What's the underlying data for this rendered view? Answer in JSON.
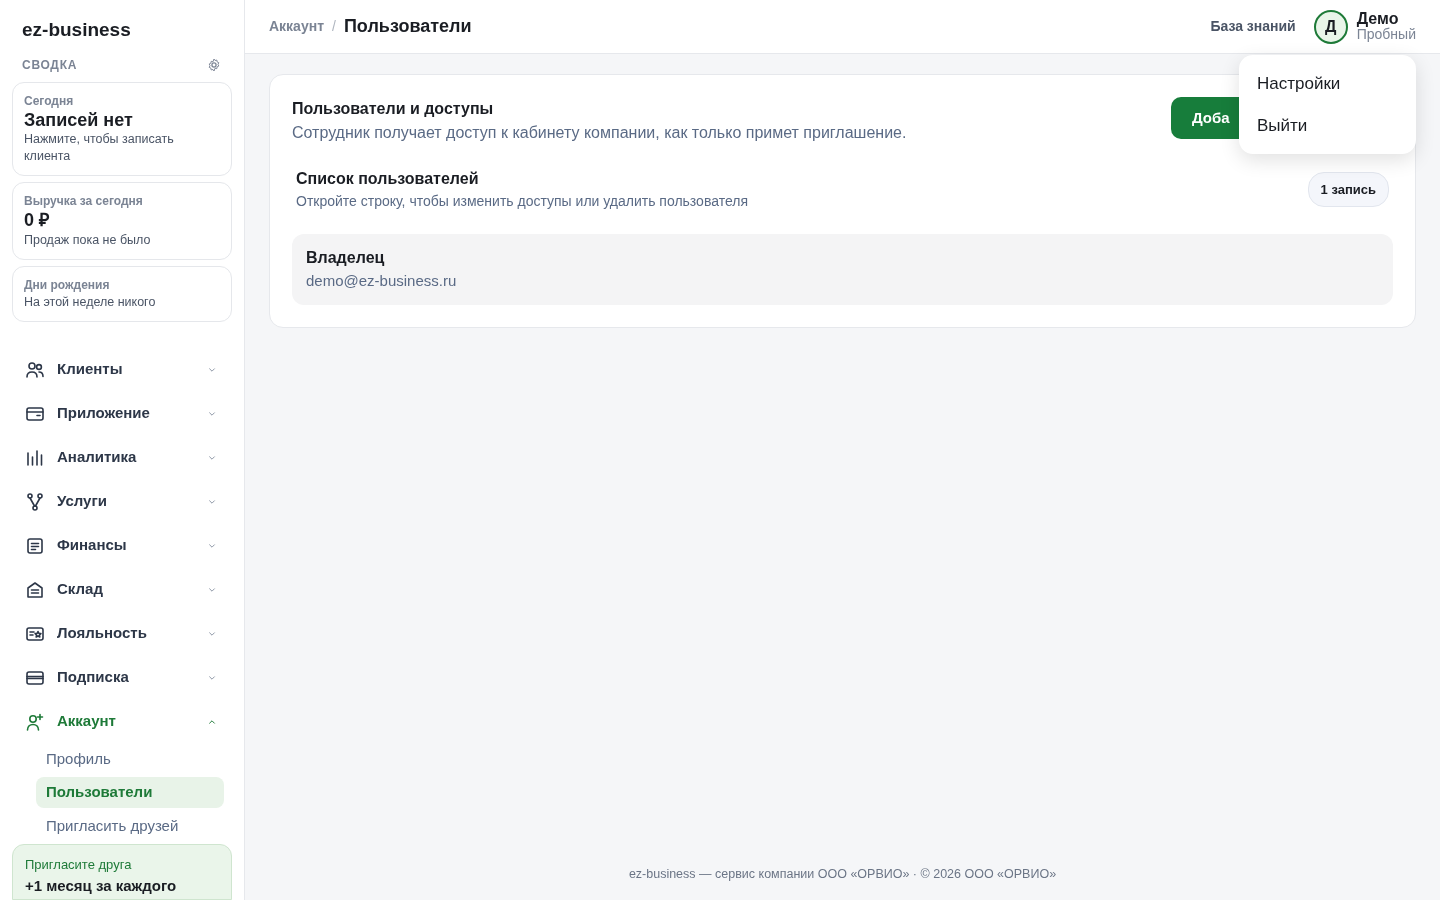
{
  "brand": "ez-business",
  "summary": {
    "title": "СВОДКА",
    "cards": [
      {
        "label": "Сегодня",
        "value": "Записей нет",
        "note": "Нажмите, чтобы записать клиента"
      },
      {
        "label": "Выручка за сегодня",
        "value": "0 ₽",
        "note": "Продаж пока не было"
      },
      {
        "label": "Дни рождения",
        "note": "На этой неделе никого"
      }
    ]
  },
  "nav": [
    {
      "label": "Клиенты",
      "expanded": false,
      "selected": false
    },
    {
      "label": "Приложение",
      "expanded": false,
      "selected": false
    },
    {
      "label": "Аналитика",
      "expanded": false,
      "selected": false
    },
    {
      "label": "Услуги",
      "expanded": false,
      "selected": false
    },
    {
      "label": "Финансы",
      "expanded": false,
      "selected": false
    },
    {
      "label": "Склад",
      "expanded": false,
      "selected": false
    },
    {
      "label": "Лояльность",
      "expanded": false,
      "selected": false
    },
    {
      "label": "Подписка",
      "expanded": false,
      "selected": false
    },
    {
      "label": "Аккаунт",
      "expanded": true,
      "selected": true,
      "children": [
        {
          "label": "Профиль",
          "selected": false
        },
        {
          "label": "Пользователи",
          "selected": true
        },
        {
          "label": "Пригласить друзей",
          "selected": false
        }
      ]
    }
  ],
  "promo": {
    "title": "Пригласите друга",
    "text": "+1 месяц за каждого"
  },
  "breadcrumb_separator": "/",
  "breadcrumb": [
    {
      "label": "Аккаунт",
      "selected": false
    },
    {
      "label": "Пользователи",
      "selected": true
    }
  ],
  "header": {
    "help_link": "База знаний",
    "user": {
      "initial": "Д",
      "name": "Демо",
      "plan": "Пробный"
    }
  },
  "menu": {
    "items": [
      "Настройки",
      "Выйти"
    ]
  },
  "panel": {
    "title": "Пользователи и доступы",
    "description": "Сотрудник получает доступ к кабинету компании, как только примет приглашение.",
    "add_button": "Доба",
    "list": {
      "title": "Список пользователей",
      "hint": "Откройте строку, чтобы изменить доступы или удалить пользователя",
      "count": "1 запись",
      "rows": [
        {
          "role": "Владелец",
          "email": "demo@ez-business.ru"
        }
      ]
    }
  },
  "footer": "ez-business — сервис компании ООО «ОРВИО» · © 2026 ООО «ОРВИО»"
}
